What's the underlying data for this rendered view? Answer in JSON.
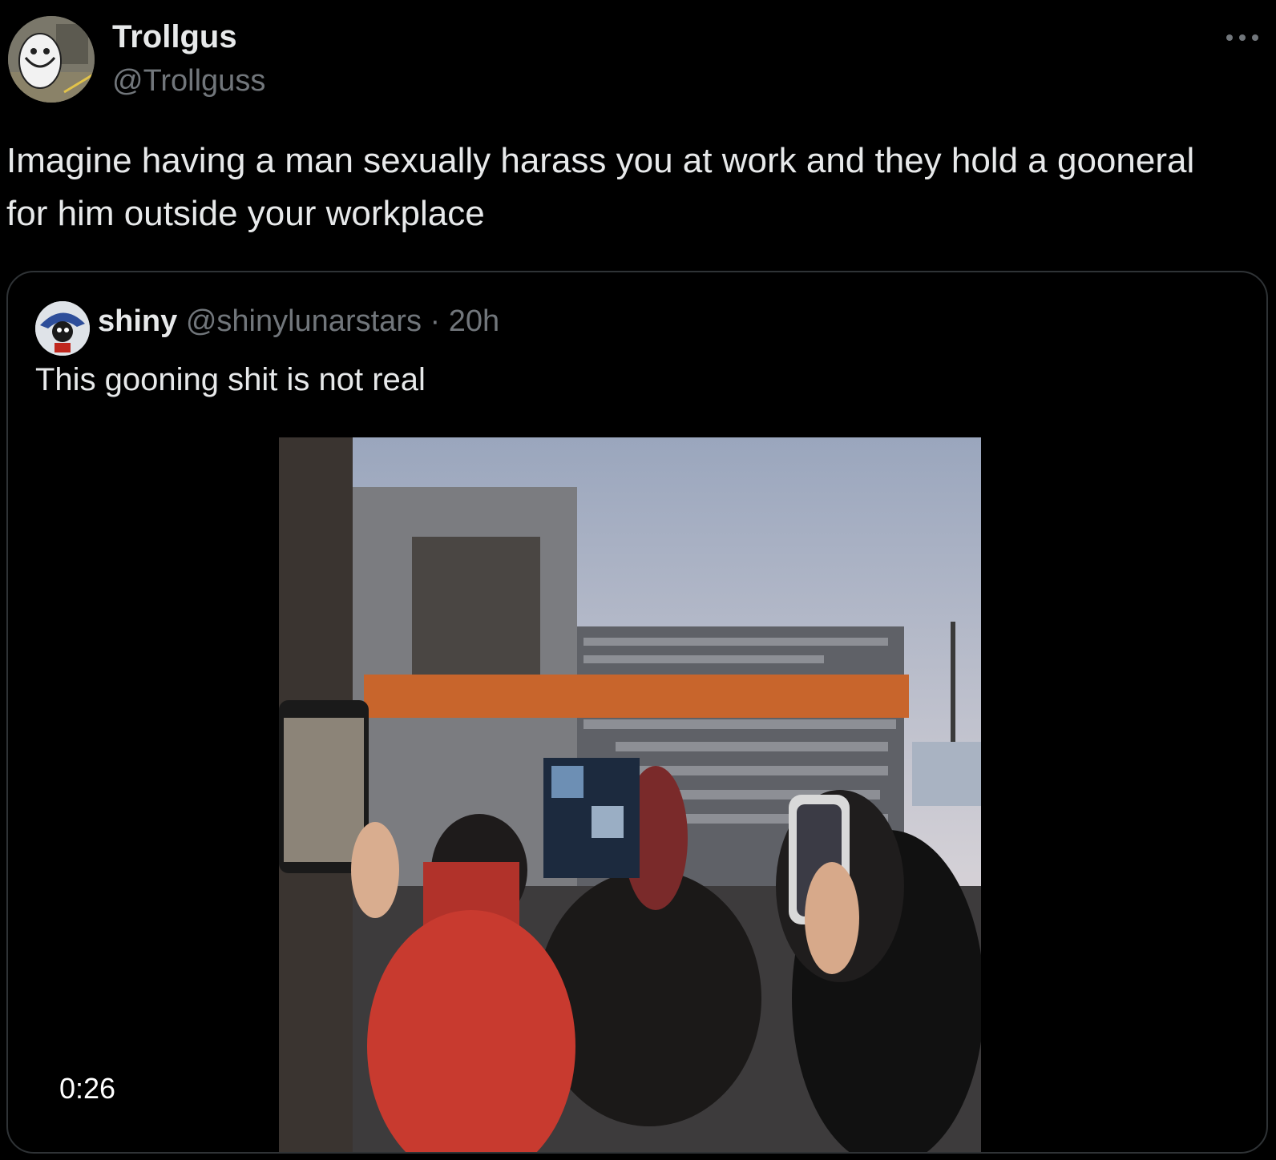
{
  "author": {
    "name": "Trollgus",
    "handle": "@Trollguss"
  },
  "tweet": {
    "text": "Imagine having a man sexually harass you at work and they hold a gooneral for him outside your workplace"
  },
  "quoted": {
    "name": "shiny",
    "handle": "@shinylunarstars",
    "separator": "·",
    "time": "20h",
    "text": "This gooning shit is not real",
    "video": {
      "duration": "0:26"
    }
  },
  "icons": {
    "more": "more-horizontal-icon"
  },
  "colors": {
    "background": "#000000",
    "text_primary": "#e7e9ea",
    "text_secondary": "#71767b",
    "border": "#2f3336"
  }
}
